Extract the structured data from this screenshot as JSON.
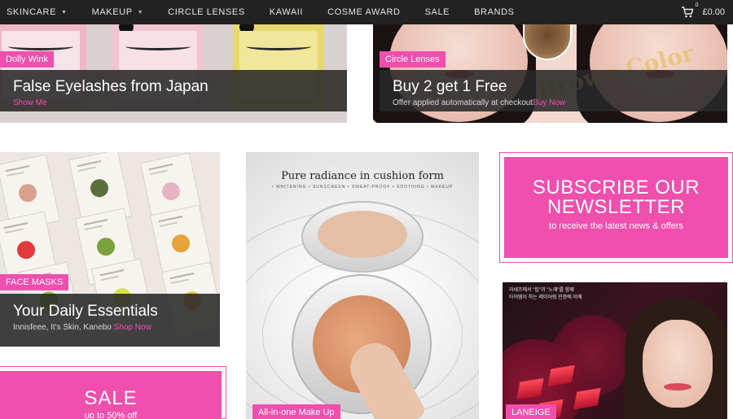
{
  "nav": {
    "items": [
      {
        "label": "SKINCARE",
        "dropdown": true
      },
      {
        "label": "MAKEUP",
        "dropdown": true
      },
      {
        "label": "CIRCLE LENSES",
        "dropdown": false
      },
      {
        "label": "KAWAII",
        "dropdown": false
      },
      {
        "label": "COSME AWARD",
        "dropdown": false
      },
      {
        "label": "SALE",
        "dropdown": false
      },
      {
        "label": "BRANDS",
        "dropdown": false
      }
    ],
    "cart": {
      "count": "0",
      "total": "£0.00"
    }
  },
  "tiles": {
    "eyelashes": {
      "tag": "Dolly Wink",
      "title": "False Eyelashes from Japan",
      "link": "Show Me"
    },
    "lenses": {
      "tag": "Circle Lenses",
      "title": "Buy 2 get 1 Free",
      "sub": "Offer applied automatically at checkout",
      "link": "Buy Now",
      "image_text": "Brown Color"
    },
    "masks": {
      "tag": "FACE MASKS",
      "title": "Your Daily Essentials",
      "sub": "Innisfeee, It's Skin, Kanebo",
      "link": "Shop Now"
    },
    "cushion": {
      "headline": "Pure radiance in cushion form",
      "subline": "• WHITENING • SUNSCREEN • SWEAT-PROOF • SOOTHING • MAKEUP",
      "tag": "All-in-one Make Up"
    },
    "newsletter": {
      "title_line1": "SUBSCRIBE OUR",
      "title_line2": "NEWSLETTER",
      "text": "to receive the latest news & offers"
    },
    "laneige": {
      "tag": "LANEIGE",
      "text_line1": "라네즈에서 \"립\"과 \"노래\"를 함께",
      "text_line2": "아이템이 하는 레이어링 인증에 이에"
    },
    "sale": {
      "title": "SALE",
      "sub": "up to 50% off"
    }
  },
  "colors": {
    "accent": "#f04fae",
    "nav_bg": "#222222"
  },
  "icons": {
    "cart": "cart-icon",
    "caret": "chevron-down-icon"
  }
}
